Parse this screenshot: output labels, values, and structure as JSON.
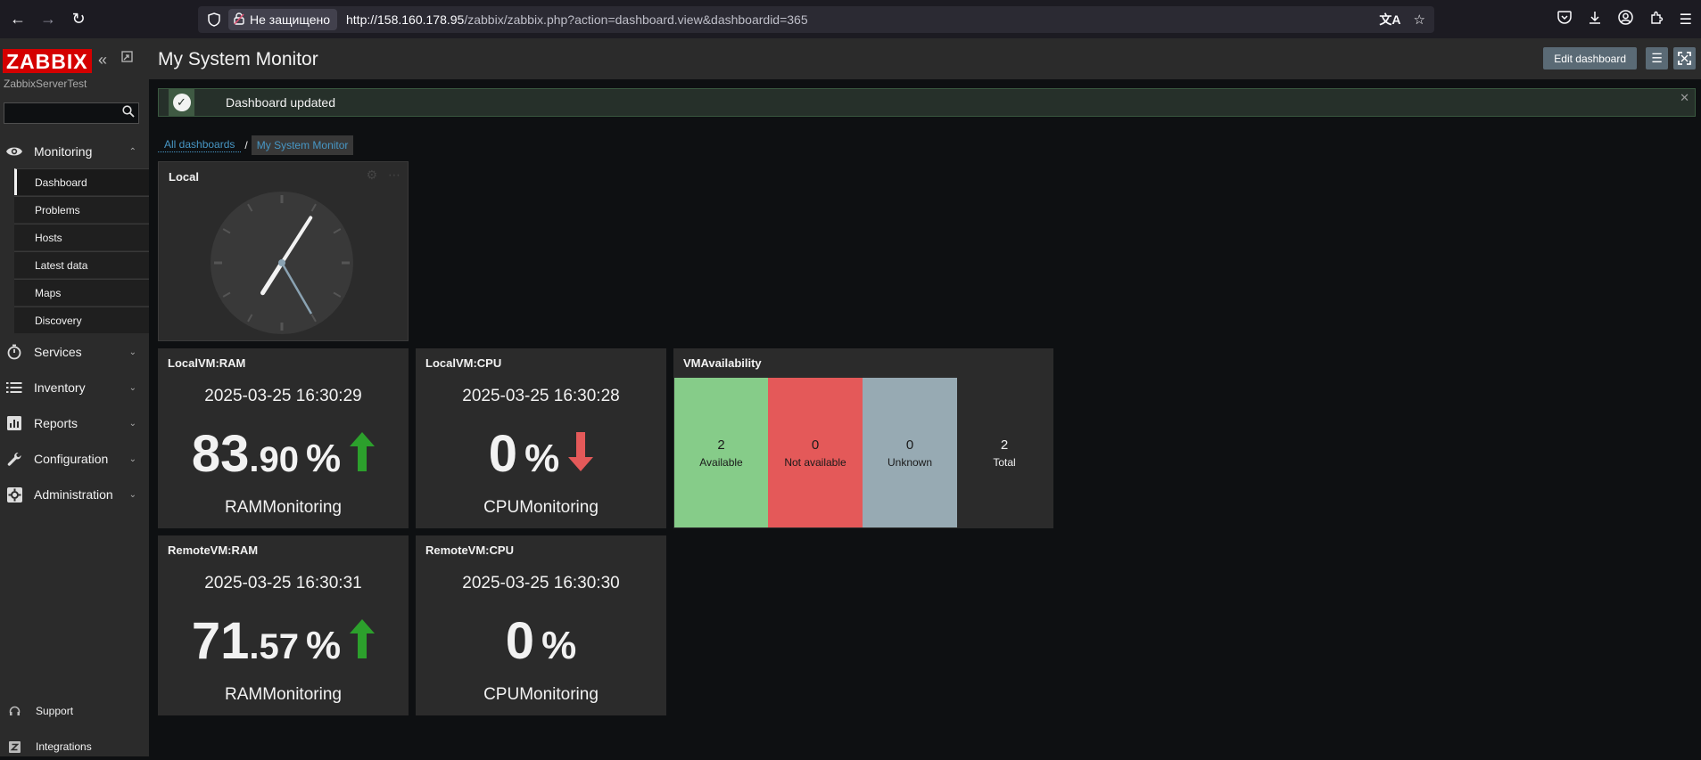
{
  "browser": {
    "security_label": "Не защищено",
    "url_host": "http://158.160.178.95",
    "url_path": "/zabbix/zabbix.php?action=dashboard.view&dashboardid=365"
  },
  "sidebar": {
    "logo": "ZABBIX",
    "server_name": "ZabbixServerTest",
    "search_placeholder": "",
    "menu": [
      {
        "label": "Monitoring",
        "icon": "eye-icon"
      },
      {
        "label": "Services",
        "icon": "stopwatch-icon"
      },
      {
        "label": "Inventory",
        "icon": "list-icon"
      },
      {
        "label": "Reports",
        "icon": "bar-chart-icon"
      },
      {
        "label": "Configuration",
        "icon": "wrench-icon"
      },
      {
        "label": "Administration",
        "icon": "gear-icon"
      }
    ],
    "monitoring_submenu": [
      "Dashboard",
      "Problems",
      "Hosts",
      "Latest data",
      "Maps",
      "Discovery"
    ],
    "bottom": [
      {
        "label": "Support",
        "icon": "headset-icon"
      },
      {
        "label": "Integrations",
        "icon": "z-icon"
      }
    ]
  },
  "header": {
    "title": "My System Monitor",
    "edit_button": "Edit dashboard"
  },
  "message": {
    "text": "Dashboard updated"
  },
  "breadcrumbs": {
    "all": "All dashboards",
    "separator": "/",
    "current": "My System Monitor"
  },
  "widgets": {
    "clock": {
      "title": "Local",
      "time": {
        "hour": 7,
        "minute": 5,
        "second": 25
      }
    },
    "local_ram": {
      "title": "LocalVM:RAM",
      "time": "2025-03-25 16:30:29",
      "value_int": "83",
      "value_dec": ".90",
      "unit": "%",
      "trend": "up",
      "desc": "RAMMonitoring"
    },
    "local_cpu": {
      "title": "LocalVM:CPU",
      "time": "2025-03-25 16:30:28",
      "value_int": "0",
      "value_dec": "",
      "unit": "%",
      "trend": "down",
      "desc": "CPUMonitoring"
    },
    "remote_ram": {
      "title": "RemoteVM:RAM",
      "time": "2025-03-25 16:30:31",
      "value_int": "71",
      "value_dec": ".57",
      "unit": "%",
      "trend": "up",
      "desc": "RAMMonitoring"
    },
    "remote_cpu": {
      "title": "RemoteVM:CPU",
      "time": "2025-03-25 16:30:30",
      "value_int": "0",
      "value_dec": "",
      "unit": "%",
      "trend": "none",
      "desc": "CPUMonitoring"
    },
    "availability": {
      "title": "VMAvailability",
      "cells": [
        {
          "count": "2",
          "label": "Available",
          "color": "#86cc89"
        },
        {
          "count": "0",
          "label": "Not available",
          "color": "#e45959"
        },
        {
          "count": "0",
          "label": "Unknown",
          "color": "#97aab3"
        },
        {
          "count": "2",
          "label": "Total",
          "color": "#2b2b2b"
        }
      ]
    }
  },
  "colors": {
    "trend_up": "#2ca02c",
    "trend_down": "#e45959",
    "logo_bg": "#d40000",
    "link": "#4796c4"
  }
}
